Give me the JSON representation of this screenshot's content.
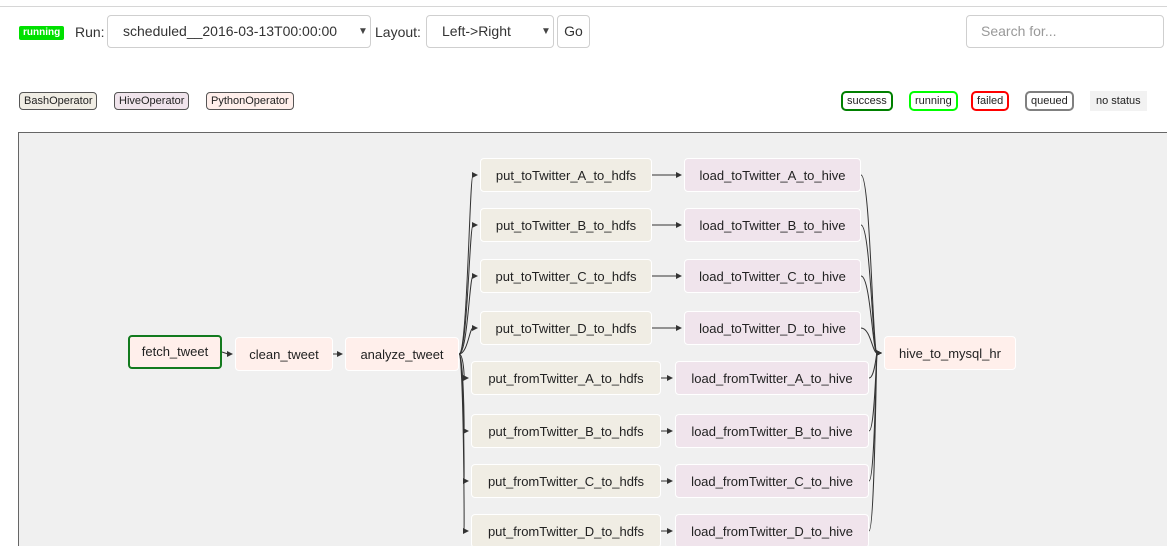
{
  "header": {
    "status_badge": "running",
    "run_label": "Run:",
    "run_value": "scheduled__2016-03-13T00:00:00",
    "layout_label": "Layout:",
    "layout_value": "Left->Right",
    "go_label": "Go",
    "search_placeholder": "Search for..."
  },
  "legend": {
    "operators": [
      {
        "label": "BashOperator",
        "color": "#f0ede4"
      },
      {
        "label": "HiveOperator",
        "color": "#f0e4ec"
      },
      {
        "label": "PythonOperator",
        "color": "#ffefeb"
      }
    ],
    "states": [
      {
        "label": "success",
        "color": "#008000"
      },
      {
        "label": "running",
        "color": "#00ff00"
      },
      {
        "label": "failed",
        "color": "#ff0000"
      },
      {
        "label": "queued",
        "color": "#808080"
      }
    ],
    "no_status_label": "no status"
  },
  "graph": {
    "nodes": {
      "fetch_tweet": {
        "label": "fetch_tweet",
        "operator": "PythonOperator",
        "state": "success"
      },
      "clean_tweet": {
        "label": "clean_tweet",
        "operator": "PythonOperator",
        "state": ""
      },
      "analyze_tweet": {
        "label": "analyze_tweet",
        "operator": "PythonOperator",
        "state": ""
      },
      "put_toTwitter_A_to_hdfs": {
        "label": "put_toTwitter_A_to_hdfs",
        "operator": "BashOperator",
        "state": ""
      },
      "put_toTwitter_B_to_hdfs": {
        "label": "put_toTwitter_B_to_hdfs",
        "operator": "BashOperator",
        "state": ""
      },
      "put_toTwitter_C_to_hdfs": {
        "label": "put_toTwitter_C_to_hdfs",
        "operator": "BashOperator",
        "state": ""
      },
      "put_toTwitter_D_to_hdfs": {
        "label": "put_toTwitter_D_to_hdfs",
        "operator": "BashOperator",
        "state": ""
      },
      "put_fromTwitter_A_to_hdfs": {
        "label": "put_fromTwitter_A_to_hdfs",
        "operator": "BashOperator",
        "state": ""
      },
      "put_fromTwitter_B_to_hdfs": {
        "label": "put_fromTwitter_B_to_hdfs",
        "operator": "BashOperator",
        "state": ""
      },
      "put_fromTwitter_C_to_hdfs": {
        "label": "put_fromTwitter_C_to_hdfs",
        "operator": "BashOperator",
        "state": ""
      },
      "put_fromTwitter_D_to_hdfs": {
        "label": "put_fromTwitter_D_to_hdfs",
        "operator": "BashOperator",
        "state": ""
      },
      "load_toTwitter_A_to_hive": {
        "label": "load_toTwitter_A_to_hive",
        "operator": "HiveOperator",
        "state": ""
      },
      "load_toTwitter_B_to_hive": {
        "label": "load_toTwitter_B_to_hive",
        "operator": "HiveOperator",
        "state": ""
      },
      "load_toTwitter_C_to_hive": {
        "label": "load_toTwitter_C_to_hive",
        "operator": "HiveOperator",
        "state": ""
      },
      "load_toTwitter_D_to_hive": {
        "label": "load_toTwitter_D_to_hive",
        "operator": "HiveOperator",
        "state": ""
      },
      "load_fromTwitter_A_to_hive": {
        "label": "load_fromTwitter_A_to_hive",
        "operator": "HiveOperator",
        "state": ""
      },
      "load_fromTwitter_B_to_hive": {
        "label": "load_fromTwitter_B_to_hive",
        "operator": "HiveOperator",
        "state": ""
      },
      "load_fromTwitter_C_to_hive": {
        "label": "load_fromTwitter_C_to_hive",
        "operator": "HiveOperator",
        "state": ""
      },
      "load_fromTwitter_D_to_hive": {
        "label": "load_fromTwitter_D_to_hive",
        "operator": "HiveOperator",
        "state": ""
      },
      "hive_to_mysql_hr": {
        "label": "hive_to_mysql_hr",
        "operator": "PythonOperator",
        "state": ""
      }
    },
    "edges": [
      [
        "fetch_tweet",
        "clean_tweet"
      ],
      [
        "clean_tweet",
        "analyze_tweet"
      ],
      [
        "analyze_tweet",
        "put_toTwitter_A_to_hdfs"
      ],
      [
        "analyze_tweet",
        "put_toTwitter_B_to_hdfs"
      ],
      [
        "analyze_tweet",
        "put_toTwitter_C_to_hdfs"
      ],
      [
        "analyze_tweet",
        "put_toTwitter_D_to_hdfs"
      ],
      [
        "analyze_tweet",
        "put_fromTwitter_A_to_hdfs"
      ],
      [
        "analyze_tweet",
        "put_fromTwitter_B_to_hdfs"
      ],
      [
        "analyze_tweet",
        "put_fromTwitter_C_to_hdfs"
      ],
      [
        "analyze_tweet",
        "put_fromTwitter_D_to_hdfs"
      ],
      [
        "put_toTwitter_A_to_hdfs",
        "load_toTwitter_A_to_hive"
      ],
      [
        "put_toTwitter_B_to_hdfs",
        "load_toTwitter_B_to_hive"
      ],
      [
        "put_toTwitter_C_to_hdfs",
        "load_toTwitter_C_to_hive"
      ],
      [
        "put_toTwitter_D_to_hdfs",
        "load_toTwitter_D_to_hive"
      ],
      [
        "put_fromTwitter_A_to_hdfs",
        "load_fromTwitter_A_to_hive"
      ],
      [
        "put_fromTwitter_B_to_hdfs",
        "load_fromTwitter_B_to_hive"
      ],
      [
        "put_fromTwitter_C_to_hdfs",
        "load_fromTwitter_C_to_hive"
      ],
      [
        "put_fromTwitter_D_to_hdfs",
        "load_fromTwitter_D_to_hive"
      ],
      [
        "load_toTwitter_A_to_hive",
        "hive_to_mysql_hr"
      ],
      [
        "load_toTwitter_B_to_hive",
        "hive_to_mysql_hr"
      ],
      [
        "load_toTwitter_C_to_hive",
        "hive_to_mysql_hr"
      ],
      [
        "load_toTwitter_D_to_hive",
        "hive_to_mysql_hr"
      ],
      [
        "load_fromTwitter_A_to_hive",
        "hive_to_mysql_hr"
      ],
      [
        "load_fromTwitter_B_to_hive",
        "hive_to_mysql_hr"
      ],
      [
        "load_fromTwitter_C_to_hive",
        "hive_to_mysql_hr"
      ],
      [
        "load_fromTwitter_D_to_hive",
        "hive_to_mysql_hr"
      ]
    ]
  }
}
